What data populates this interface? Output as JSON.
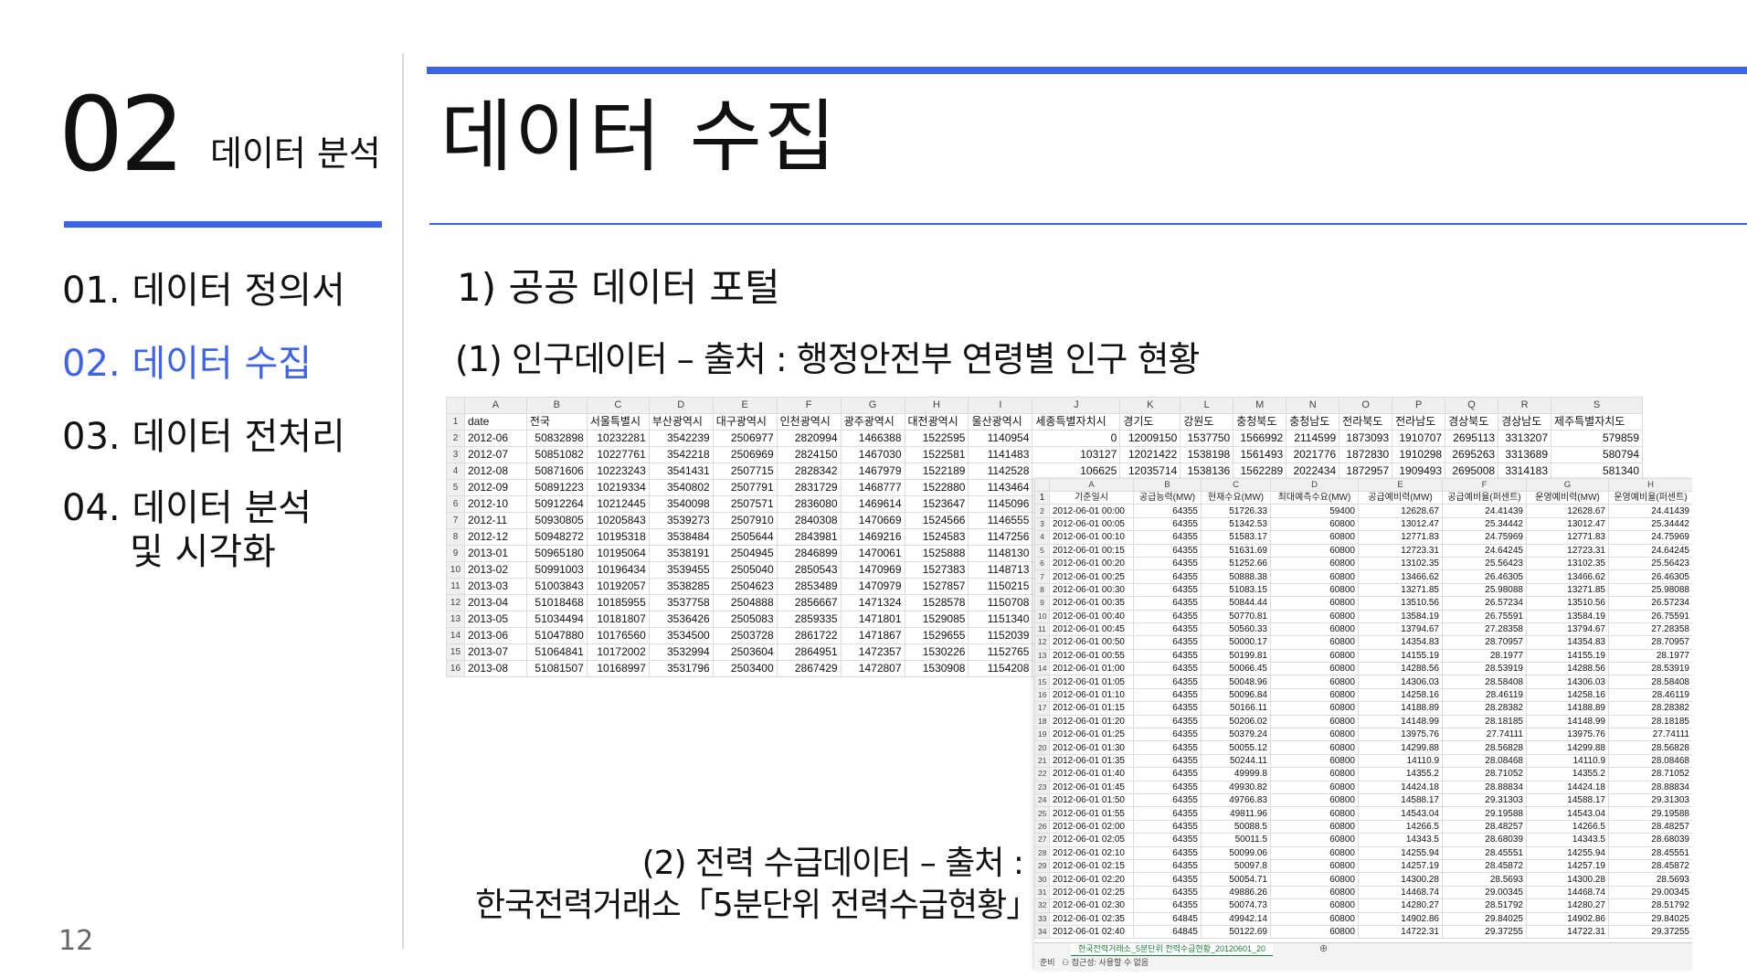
{
  "left": {
    "section_number": "02",
    "section_title": "데이터 분석",
    "menu": [
      {
        "label": "01. 데이터 정의서"
      },
      {
        "label": "02. 데이터 수집"
      },
      {
        "label": "03. 데이터 전처리"
      },
      {
        "label": "04. 데이터 분석",
        "label2": "및 시각화"
      }
    ],
    "page_number": "12"
  },
  "main": {
    "title": "데이터 수집",
    "subheading": "1) 공공 데이터 포털",
    "item1": "(1) 인구데이터 – 출처 : 행정안전부 연령별 인구 현황",
    "item2_line1": "(2) 전력 수급데이터 – 출처 :",
    "item2_line2": "한국전력거래소「5분단위 전력수급현황」"
  },
  "colors": {
    "accent": "#3f63e8"
  },
  "sheet1": {
    "col_letters": [
      "A",
      "B",
      "C",
      "D",
      "E",
      "F",
      "G",
      "H",
      "I",
      "J",
      "K",
      "L",
      "M",
      "N",
      "O",
      "P",
      "Q",
      "R",
      "S"
    ],
    "headers": [
      "date",
      "전국",
      "서울특별시",
      "부산광역시",
      "대구광역시",
      "인천광역시",
      "광주광역시",
      "대전광역시",
      "울산광역시",
      "세종특별자치시",
      "경기도",
      "강원도",
      "충청북도",
      "충청남도",
      "전라북도",
      "전라남도",
      "경상북도",
      "경상남도",
      "제주특별자치도"
    ],
    "rows": [
      [
        "2012-06",
        "50832898",
        "10232281",
        "3542239",
        "2506977",
        "2820994",
        "1466388",
        "1522595",
        "1140954",
        "0",
        "12009150",
        "1537750",
        "1566992",
        "2114599",
        "1873093",
        "1910707",
        "2695113",
        "3313207",
        "579859"
      ],
      [
        "2012-07",
        "50851082",
        "10227761",
        "3542218",
        "2506969",
        "2824150",
        "1467030",
        "1522581",
        "1141483",
        "103127",
        "12021422",
        "1538198",
        "1561493",
        "2021776",
        "1872830",
        "1910298",
        "2695263",
        "3313689",
        "580794"
      ],
      [
        "2012-08",
        "50871606",
        "10223243",
        "3541431",
        "2507715",
        "2828342",
        "1467979",
        "1522189",
        "1142528",
        "106625",
        "12035714",
        "1538136",
        "1562289",
        "2022434",
        "1872957",
        "1909493",
        "2695008",
        "3314183",
        "581340"
      ],
      [
        "2012-09",
        "50891223",
        "10219334",
        "3540802",
        "2507791",
        "2831729",
        "1468777",
        "1522880",
        "1143464",
        "",
        "",
        "",
        "",
        "",
        "",
        "",
        "",
        "",
        ""
      ],
      [
        "2012-10",
        "50912264",
        "10212445",
        "3540098",
        "2507571",
        "2836080",
        "1469614",
        "1523647",
        "1145096",
        "",
        "",
        "",
        "",
        "",
        "",
        "",
        "",
        "",
        ""
      ],
      [
        "2012-11",
        "50930805",
        "10205843",
        "3539273",
        "2507910",
        "2840308",
        "1470669",
        "1524566",
        "1146555",
        "",
        "",
        "",
        "",
        "",
        "",
        "",
        "",
        "",
        ""
      ],
      [
        "2012-12",
        "50948272",
        "10195318",
        "3538484",
        "2505644",
        "2843981",
        "1469216",
        "1524583",
        "1147256",
        "",
        "",
        "",
        "",
        "",
        "",
        "",
        "",
        "",
        ""
      ],
      [
        "2013-01",
        "50965180",
        "10195064",
        "3538191",
        "2504945",
        "2846899",
        "1470061",
        "1525888",
        "1148130",
        "",
        "",
        "",
        "",
        "",
        "",
        "",
        "",
        "",
        ""
      ],
      [
        "2013-02",
        "50991003",
        "10196434",
        "3539455",
        "2505040",
        "2850543",
        "1470969",
        "1527383",
        "1148713",
        "",
        "",
        "",
        "",
        "",
        "",
        "",
        "",
        "",
        ""
      ],
      [
        "2013-03",
        "51003843",
        "10192057",
        "3538285",
        "2504623",
        "2853489",
        "1470979",
        "1527857",
        "1150215",
        "",
        "",
        "",
        "",
        "",
        "",
        "",
        "",
        "",
        ""
      ],
      [
        "2013-04",
        "51018468",
        "10185955",
        "3537758",
        "2504888",
        "2856667",
        "1471324",
        "1528578",
        "1150708",
        "",
        "",
        "",
        "",
        "",
        "",
        "",
        "",
        "",
        ""
      ],
      [
        "2013-05",
        "51034494",
        "10181807",
        "3536426",
        "2505083",
        "2859335",
        "1471801",
        "1529085",
        "1151340",
        "",
        "",
        "",
        "",
        "",
        "",
        "",
        "",
        "",
        ""
      ],
      [
        "2013-06",
        "51047880",
        "10176560",
        "3534500",
        "2503728",
        "2861722",
        "1471867",
        "1529655",
        "1152039",
        "",
        "",
        "",
        "",
        "",
        "",
        "",
        "",
        "",
        ""
      ],
      [
        "2013-07",
        "51064841",
        "10172002",
        "3532994",
        "2503604",
        "2864951",
        "1472357",
        "1530226",
        "1152765",
        "",
        "",
        "",
        "",
        "",
        "",
        "",
        "",
        "",
        ""
      ],
      [
        "2013-08",
        "51081507",
        "10168997",
        "3531796",
        "2503400",
        "2867429",
        "1472807",
        "1530908",
        "1154208",
        "",
        "",
        "",
        "",
        "",
        "",
        "",
        "",
        "",
        ""
      ]
    ]
  },
  "sheet2": {
    "col_letters": [
      "A",
      "B",
      "C",
      "D",
      "E",
      "F",
      "G",
      "H"
    ],
    "headers": [
      "기준일시",
      "공급능력(MW)",
      "현재수요(MW)",
      "최대예측수요(MW)",
      "공급예비력(MW)",
      "공급예비율(퍼센트)",
      "운영예비력(MW)",
      "운영예비율(퍼센트)"
    ],
    "rows": [
      [
        "2012-06-01 00:00",
        "64355",
        "51726.33",
        "59400",
        "12628.67",
        "24.41439",
        "12628.67",
        "24.41439"
      ],
      [
        "2012-06-01 00:05",
        "64355",
        "51342.53",
        "60800",
        "13012.47",
        "25.34442",
        "13012.47",
        "25.34442"
      ],
      [
        "2012-06-01 00:10",
        "64355",
        "51583.17",
        "60800",
        "12771.83",
        "24.75969",
        "12771.83",
        "24.75969"
      ],
      [
        "2012-06-01 00:15",
        "64355",
        "51631.69",
        "60800",
        "12723.31",
        "24.64245",
        "12723.31",
        "24.64245"
      ],
      [
        "2012-06-01 00:20",
        "64355",
        "51252.66",
        "60800",
        "13102.35",
        "25.56423",
        "13102.35",
        "25.56423"
      ],
      [
        "2012-06-01 00:25",
        "64355",
        "50888.38",
        "60800",
        "13466.62",
        "26.46305",
        "13466.62",
        "26.46305"
      ],
      [
        "2012-06-01 00:30",
        "64355",
        "51083.15",
        "60800",
        "13271.85",
        "25.98088",
        "13271.85",
        "25.98088"
      ],
      [
        "2012-06-01 00:35",
        "64355",
        "50844.44",
        "60800",
        "13510.56",
        "26.57234",
        "13510.56",
        "26.57234"
      ],
      [
        "2012-06-01 00:40",
        "64355",
        "50770.81",
        "60800",
        "13584.19",
        "26.75591",
        "13584.19",
        "26.75591"
      ],
      [
        "2012-06-01 00:45",
        "64355",
        "50560.33",
        "60800",
        "13794.67",
        "27.28358",
        "13794.67",
        "27.28358"
      ],
      [
        "2012-06-01 00:50",
        "64355",
        "50000.17",
        "60800",
        "14354.83",
        "28.70957",
        "14354.83",
        "28.70957"
      ],
      [
        "2012-06-01 00:55",
        "64355",
        "50199.81",
        "60800",
        "14155.19",
        "28.1977",
        "14155.19",
        "28.1977"
      ],
      [
        "2012-06-01 01:00",
        "64355",
        "50066.45",
        "60800",
        "14288.56",
        "28.53919",
        "14288.56",
        "28.53919"
      ],
      [
        "2012-06-01 01:05",
        "64355",
        "50048.96",
        "60800",
        "14306.03",
        "28.58408",
        "14306.03",
        "28.58408"
      ],
      [
        "2012-06-01 01:10",
        "64355",
        "50096.84",
        "60800",
        "14258.16",
        "28.46119",
        "14258.16",
        "28.46119"
      ],
      [
        "2012-06-01 01:15",
        "64355",
        "50166.11",
        "60800",
        "14188.89",
        "28.28382",
        "14188.89",
        "28.28382"
      ],
      [
        "2012-06-01 01:20",
        "64355",
        "50206.02",
        "60800",
        "14148.99",
        "28.18185",
        "14148.99",
        "28.18185"
      ],
      [
        "2012-06-01 01:25",
        "64355",
        "50379.24",
        "60800",
        "13975.76",
        "27.74111",
        "13975.76",
        "27.74111"
      ],
      [
        "2012-06-01 01:30",
        "64355",
        "50055.12",
        "60800",
        "14299.88",
        "28.56828",
        "14299.88",
        "28.56828"
      ],
      [
        "2012-06-01 01:35",
        "64355",
        "50244.11",
        "60800",
        "14110.9",
        "28.08468",
        "14110.9",
        "28.08468"
      ],
      [
        "2012-06-01 01:40",
        "64355",
        "49999.8",
        "60800",
        "14355.2",
        "28.71052",
        "14355.2",
        "28.71052"
      ],
      [
        "2012-06-01 01:45",
        "64355",
        "49930.82",
        "60800",
        "14424.18",
        "28.88834",
        "14424.18",
        "28.88834"
      ],
      [
        "2012-06-01 01:50",
        "64355",
        "49766.83",
        "60800",
        "14588.17",
        "29.31303",
        "14588.17",
        "29.31303"
      ],
      [
        "2012-06-01 01:55",
        "64355",
        "49811.96",
        "60800",
        "14543.04",
        "29.19588",
        "14543.04",
        "29.19588"
      ],
      [
        "2012-06-01 02:00",
        "64355",
        "50088.5",
        "60800",
        "14266.5",
        "28.48257",
        "14266.5",
        "28.48257"
      ],
      [
        "2012-06-01 02:05",
        "64355",
        "50011.5",
        "60800",
        "14343.5",
        "28.68039",
        "14343.5",
        "28.68039"
      ],
      [
        "2012-06-01 02:10",
        "64355",
        "50099.06",
        "60800",
        "14255.94",
        "28.45551",
        "14255.94",
        "28.45551"
      ],
      [
        "2012-06-01 02:15",
        "64355",
        "50097.8",
        "60800",
        "14257.19",
        "28.45872",
        "14257.19",
        "28.45872"
      ],
      [
        "2012-06-01 02:20",
        "64355",
        "50054.71",
        "60800",
        "14300.28",
        "28.5693",
        "14300.28",
        "28.5693"
      ],
      [
        "2012-06-01 02:25",
        "64355",
        "49886.26",
        "60800",
        "14468.74",
        "29.00345",
        "14468.74",
        "29.00345"
      ],
      [
        "2012-06-01 02:30",
        "64355",
        "50074.73",
        "60800",
        "14280.27",
        "28.51792",
        "14280.27",
        "28.51792"
      ],
      [
        "2012-06-01 02:35",
        "64845",
        "49942.14",
        "60800",
        "14902.86",
        "29.84025",
        "14902.86",
        "29.84025"
      ],
      [
        "2012-06-01 02:40",
        "64845",
        "50122.69",
        "60800",
        "14722.31",
        "29.37255",
        "14722.31",
        "29.37255"
      ]
    ],
    "sheet_tab": "한국전력거래소_5분단위 전력수급현황_20120601_20",
    "add_sheet": "⊕",
    "status_ready": "준비",
    "status_accessibility": "접근성: 사용할 수 없음"
  }
}
